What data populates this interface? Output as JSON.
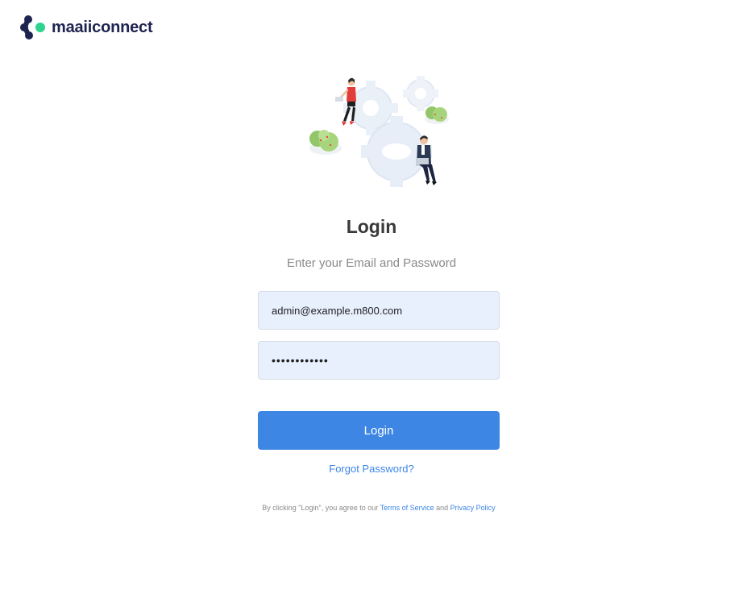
{
  "brand": {
    "name": "maaiiconnect",
    "mark_color_dark": "#1d2450",
    "mark_color_accent": "#2ed38f"
  },
  "login": {
    "title": "Login",
    "subtitle": "Enter your Email and Password",
    "email_value": "admin@example.m800.com",
    "password_value": "passwordpass",
    "submit_label": "Login",
    "forgot_label": "Forgot Password?"
  },
  "terms": {
    "prefix": "By clicking \"Login\", you agree to our ",
    "tos_label": "Terms of Service",
    "and_label": " and ",
    "privacy_label": "Privacy Policy"
  },
  "colors": {
    "primary": "#3d86e4",
    "field_bg": "#e8f0fe",
    "title": "#3a3a3a",
    "muted": "#8a8a8a"
  },
  "illustration": {
    "icon": "gears-with-people-illustration"
  }
}
